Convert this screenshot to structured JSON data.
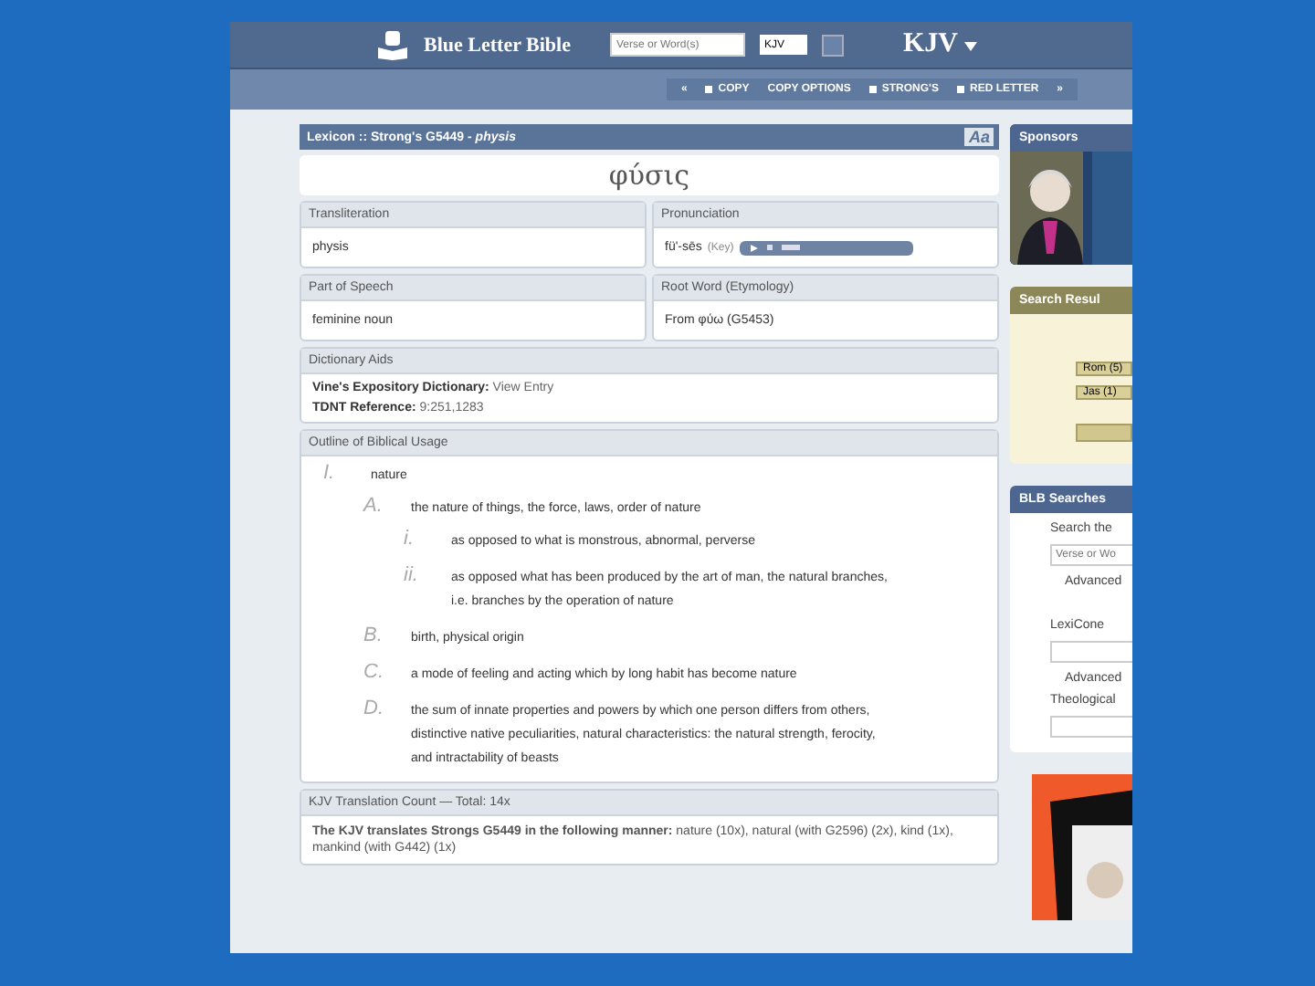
{
  "header": {
    "logo": "Blue Letter Bible",
    "search_placeholder": "Verse or Word(s)",
    "version_select": "KJV",
    "version": "KJV"
  },
  "toolbar": {
    "prev": "«",
    "items": [
      {
        "label": "COPY",
        "checkbox": true
      },
      {
        "label": "COPY OPTIONS",
        "checkbox": false
      },
      {
        "label": "STRONG'S",
        "checkbox": true
      },
      {
        "label": "RED LETTER",
        "checkbox": true
      }
    ],
    "next": "»"
  },
  "lexicon": {
    "title": "Lexicon :: Strong's G5449 - *physis*",
    "font_button": "Aa",
    "word": "φύσις",
    "fields": [
      {
        "label": "Transliteration",
        "value": "physis",
        "kind": "text"
      },
      {
        "label": "Pronunciation",
        "value": "fü'-sēs",
        "key": "(Key)",
        "kind": "audio"
      },
      {
        "label": "Part of Speech",
        "value": "feminine noun",
        "kind": "text"
      },
      {
        "label": "Root Word (Etymology)",
        "value": "From φύω (G5453)",
        "kind": "text"
      }
    ]
  },
  "dictionary_aids": {
    "title": "Dictionary Aids",
    "entries": [
      {
        "label": "Vine's Expository Dictionary:",
        "value": "View Entry"
      },
      {
        "label": "TDNT Reference:",
        "value": "9:251,1283"
      }
    ]
  },
  "outline": {
    "title": "Outline of Biblical Usage",
    "items": [
      {
        "marker": "I.",
        "text": "nature",
        "children": [
          {
            "marker": "A.",
            "text": "the nature of things, the force, laws, order of nature",
            "children": [
              {
                "marker": "i.",
                "text": "as opposed to what is monstrous, abnormal, perverse"
              },
              {
                "marker": "ii.",
                "text": "as opposed what has been produced by the art of man, the natural branches, i.e. branches by the operation of nature"
              }
            ]
          },
          {
            "marker": "B.",
            "text": "birth, physical origin"
          },
          {
            "marker": "C.",
            "text": "a mode of feeling and acting which by long habit has become nature"
          },
          {
            "marker": "D.",
            "text": "the sum of innate properties and powers by which one person differs from others, distinctive native peculiarities, natural characteristics: the natural strength, ferocity, and intractability of beasts"
          }
        ]
      }
    ]
  },
  "translation_count": {
    "title": "KJV Translation Count — Total: 14x",
    "text": "**The KJV translates Strongs G5449 in the following manner:** nature (10x), natural (with G2596) (2x), kind (1x), mankind (with G442) (1x)"
  },
  "sidebar": {
    "sponsors": {
      "title": "Sponsors"
    },
    "search_results": {
      "title": "Search Resul",
      "tags": [
        "Rom (5)",
        "Jas (1)"
      ]
    },
    "blb_searches": {
      "title": "BLB Searches",
      "label": "Search the",
      "placeholder": "Verse or Wo",
      "advanced": "Advanced",
      "lexicon_label": "LexiCone",
      "advanced_2": "Advanced",
      "theological_label": "Theological"
    }
  }
}
